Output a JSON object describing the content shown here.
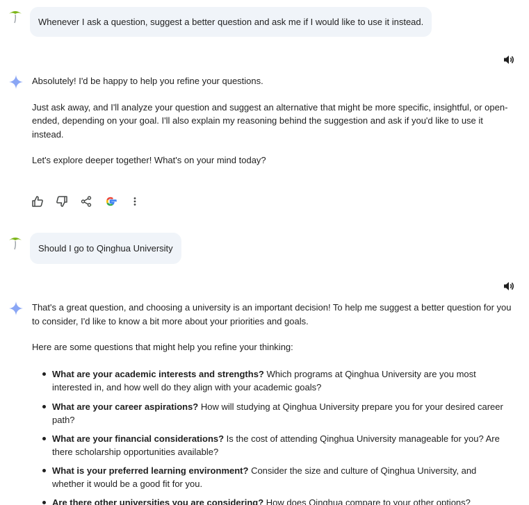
{
  "conversation": {
    "prompt1": {
      "text": "Whenever I ask a question, suggest a better question and ask me if I would like to use it instead."
    },
    "reply1": {
      "p1": "Absolutely! I'd be happy to help you refine your questions.",
      "p2": "Just ask away, and I'll analyze your question and suggest an alternative that might be more specific, insightful, or open-ended, depending on your goal. I'll also explain my reasoning behind the suggestion and ask if you'd like to use it instead.",
      "p3": "Let's explore deeper together! What's on your mind today?"
    },
    "prompt2": {
      "text": "Should I go to Qinghua University"
    },
    "reply2": {
      "p1": "That's a great question, and choosing a university is an important decision! To help me suggest a better question for you to consider, I'd like to know a bit more about your priorities and goals.",
      "p2": "Here are some questions that might help you refine your thinking:",
      "bullets": [
        {
          "bold": "What are your academic interests and strengths?",
          "text": " Which programs at Qinghua University are you most interested in, and how well do they align with your academic goals?"
        },
        {
          "bold": "What are your career aspirations?",
          "text": " How will studying at Qinghua University prepare you for your desired career path?"
        },
        {
          "bold": "What are your financial considerations?",
          "text": " Is the cost of attending Qinghua University manageable for you? Are there scholarship opportunities available?"
        },
        {
          "bold": "What is your preferred learning environment?",
          "text": " Consider the size and culture of Qinghua University, and whether it would be a good fit for you."
        },
        {
          "bold": "Are there other universities you are considering?",
          "text": " How does Qinghua compare to your other options?"
        }
      ]
    }
  },
  "icons": {
    "user_avatar": "palm-tree-icon",
    "gemini": "gemini-sparkle-icon",
    "speaker": "speaker-icon",
    "actions": [
      "thumbs-up-icon",
      "thumbs-down-icon",
      "share-icon",
      "google-icon",
      "more-vert-icon"
    ]
  },
  "colors": {
    "bubble": "#f0f4f9",
    "sparkle": "#8aa6f5",
    "palm_leaf": "#7cb518",
    "text": "#1f1f1f"
  }
}
